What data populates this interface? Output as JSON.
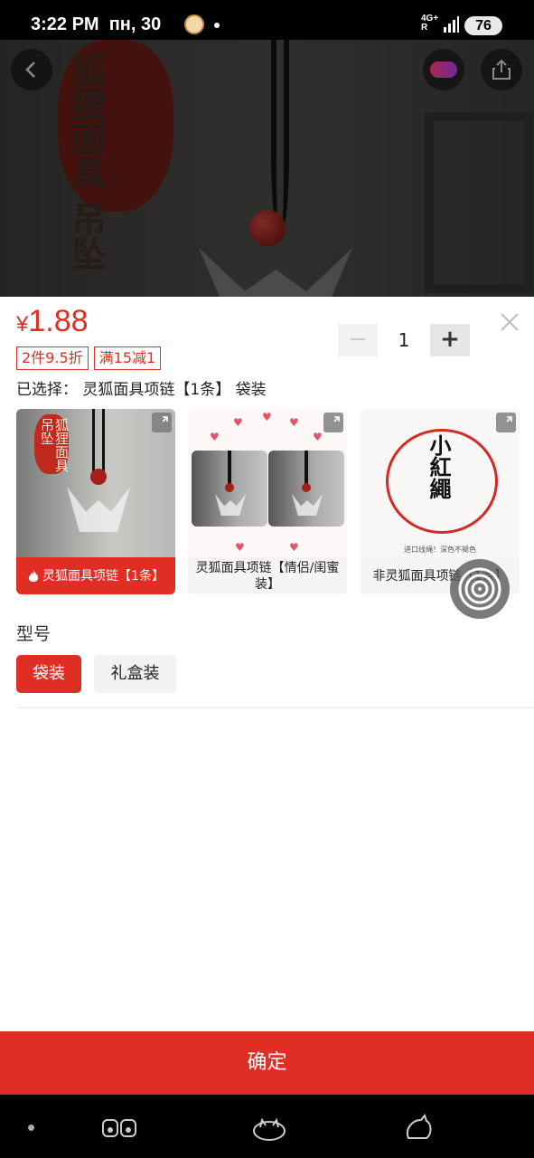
{
  "status_bar": {
    "time": "3:22 PM",
    "date": "пн, 30",
    "network": "4G+",
    "network_r": "R",
    "battery": "76"
  },
  "hero": {
    "seal_text": "狐狸面具 吊坠"
  },
  "sheet": {
    "price_symbol": "¥",
    "price": "1.88",
    "promos": [
      "2件9.5折",
      "满15减1"
    ],
    "quantity": "1",
    "minus": "−",
    "plus": "+",
    "selected_text": "已选择： 灵狐面具项链【1条】 袋装",
    "variants": [
      {
        "label": "灵狐面具项链【1条】",
        "active": true,
        "seal": "狐狸面具吊坠"
      },
      {
        "label": "灵狐面具项链【情侣/闺蜜装】",
        "active": false
      },
      {
        "label": "非灵狐面具项链【1条】",
        "active": false,
        "title": "小紅繩",
        "note": "进口线绳！深色不褪色"
      }
    ],
    "model_label": "型号",
    "options": [
      {
        "label": "袋装",
        "selected": true
      },
      {
        "label": "礼盒装",
        "selected": false
      }
    ],
    "confirm": "确定"
  },
  "colors": {
    "accent": "#e02e24"
  }
}
